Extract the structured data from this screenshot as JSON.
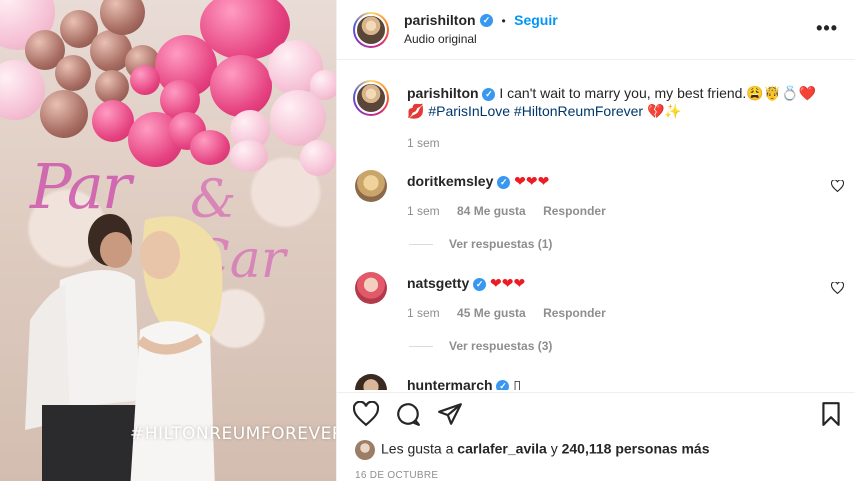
{
  "media": {
    "sign_left": "Par",
    "sign_right": "& Car",
    "overlay_hashtag": "#HILTONREUMFOREVER"
  },
  "header": {
    "username": "parishilton",
    "verified_mark": "✓",
    "follow_label": "Seguir",
    "separator": "•",
    "subtitle": "Audio original",
    "more_label": "•••"
  },
  "caption": {
    "username": "parishilton",
    "text": " I can't wait to marry you, my best friend.",
    "emojis": "😩🤴💍❤️",
    "line2_emoji_start": "💋",
    "hashtags": "#ParisInLove #HiltonReumForever",
    "line2_emoji_end": "💔✨",
    "time": "1 sem"
  },
  "comments": [
    {
      "username": "doritkemsley",
      "text": "❤❤❤",
      "time": "1 sem",
      "likes": "84 Me gusta",
      "reply_label": "Responder",
      "view_replies": "Ver respuestas (1)"
    },
    {
      "username": "natsgetty",
      "text": "❤❤❤",
      "time": "1 sem",
      "likes": "45 Me gusta",
      "reply_label": "Responder",
      "view_replies": "Ver respuestas (3)"
    },
    {
      "username": "huntermarch",
      "text": "▯"
    }
  ],
  "footer": {
    "likes_prefix": "Les gusta a ",
    "likes_user": "carlafer_avila",
    "likes_middle": " y ",
    "likes_count": "240,118 personas más",
    "date": "16 DE OCTUBRE"
  },
  "colors": {
    "accent": "#0095f6",
    "verified": "#3897f0",
    "heart": "#ed1c24"
  }
}
